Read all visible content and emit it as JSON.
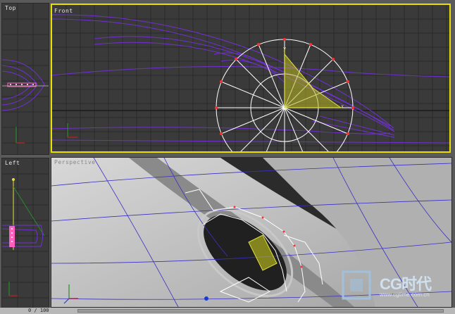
{
  "viewports": {
    "top": {
      "label": "Top"
    },
    "front": {
      "label": "Front",
      "active": true
    },
    "left": {
      "label": "Left"
    },
    "perspective": {
      "label": "Perspective"
    }
  },
  "gizmo": {
    "y_axis": "y",
    "x_axis": "x"
  },
  "timeline": {
    "frame_counter": "0 / 100"
  },
  "watermark": {
    "brand": "CG时代",
    "url": "www.cgtime.com.cn"
  },
  "colors": {
    "active_border": "#e8e000",
    "wire_purple": "#7030d0",
    "grid": "#2a2a2a",
    "selection_white": "#ffffff",
    "vertex_red": "#ff3030",
    "gizmo_yellow": "#d8d820"
  }
}
